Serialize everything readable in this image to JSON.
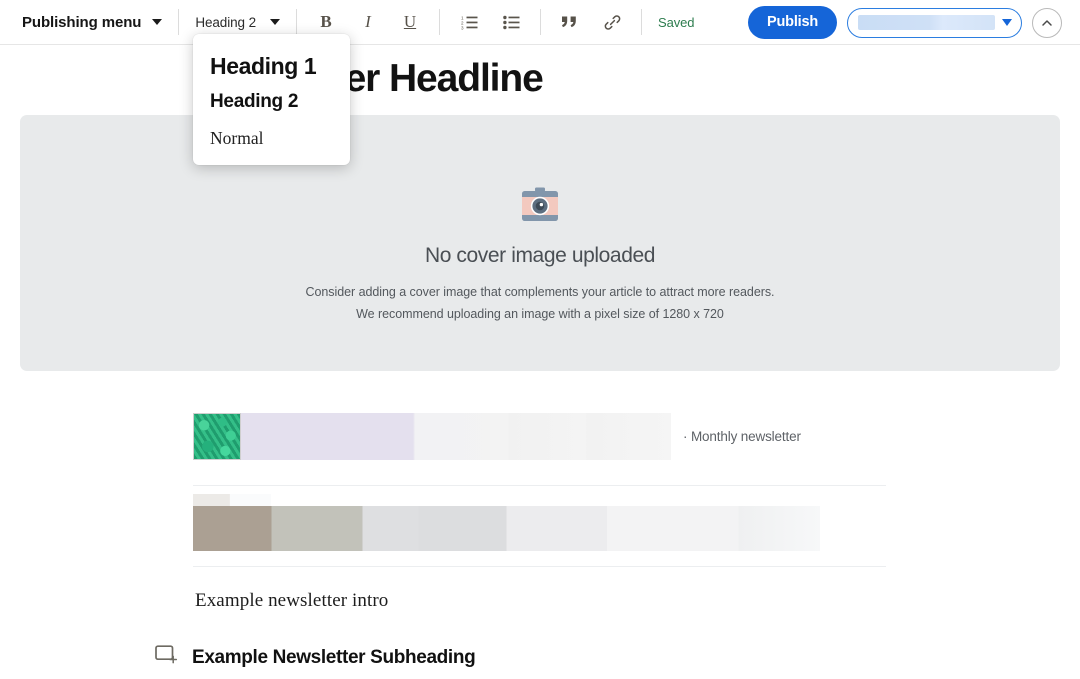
{
  "toolbar": {
    "publishing_menu_label": "Publishing menu",
    "publishing_menu_caret": "chevron-down-icon",
    "style_selector_value": "Heading 2",
    "bold_label": "B",
    "italic_label": "I",
    "underline_label": "U",
    "numbered_list_icon": "numbered-list-icon",
    "bulleted_list_icon": "bulleted-list-icon",
    "quote_icon": "blockquote-icon",
    "link_icon": "link-icon",
    "save_status": "Saved",
    "publish_label": "Publish",
    "publication_select_value": "",
    "collapse_icon": "chevron-up-icon",
    "accent_color": "#1565d8",
    "saved_color": "#2e7d4f"
  },
  "style_dropdown": {
    "open": true,
    "options": [
      {
        "label": "Heading 1",
        "style": "h1"
      },
      {
        "label": "Heading 2",
        "style": "h2"
      },
      {
        "label": "Normal",
        "style": "normal"
      }
    ]
  },
  "editor": {
    "headline": "Newsletter Headline",
    "cover": {
      "icon": "camera-icon",
      "title": "No cover image uploaded",
      "line1": "Consider adding a cover image that complements your article to attract more readers.",
      "line2": "We recommend uploading an image with a pixel size of 1280 x 720",
      "background_color": "#e8eaeb"
    },
    "blocks": [
      {
        "type": "embed-block",
        "thumbnail": "green-foliage-thumbnail",
        "caption": "· Monthly newsletter"
      },
      {
        "type": "placeholder-block"
      }
    ],
    "intro_text": "Example newsletter intro",
    "subheading": {
      "add_block_icon": "add-image-block-icon",
      "text": "Example Newsletter Subheading"
    }
  }
}
